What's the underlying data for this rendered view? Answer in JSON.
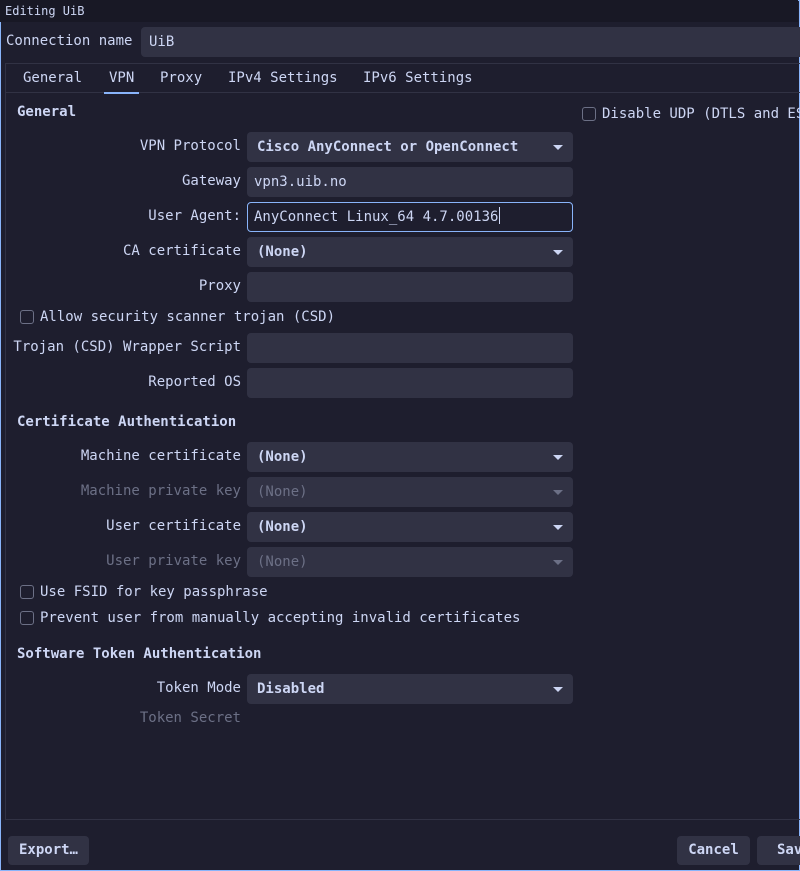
{
  "window": {
    "title": "Editing UiB"
  },
  "connection": {
    "label": "Connection name",
    "value": "UiB"
  },
  "tabs": [
    {
      "label": "General"
    },
    {
      "label": "VPN"
    },
    {
      "label": "Proxy"
    },
    {
      "label": "IPv4 Settings"
    },
    {
      "label": "IPv6 Settings"
    }
  ],
  "active_tab": "VPN",
  "general": {
    "heading": "General",
    "vpn_protocol": {
      "label": "VPN Protocol",
      "value": "Cisco AnyConnect or OpenConnect"
    },
    "gateway": {
      "label": "Gateway",
      "value": "vpn3.uib.no"
    },
    "user_agent": {
      "label": "User Agent:",
      "value": "AnyConnect Linux_64 4.7.00136"
    },
    "ca_certificate": {
      "label": "CA certificate",
      "value": "(None)"
    },
    "proxy": {
      "label": "Proxy",
      "value": ""
    },
    "allow_csd": {
      "label": "Allow security scanner trojan (CSD)",
      "checked": false
    },
    "csd_wrapper": {
      "label": "Trojan (CSD) Wrapper Script",
      "value": ""
    },
    "reported_os": {
      "label": "Reported OS",
      "value": ""
    },
    "disable_udp": {
      "label": "Disable UDP (DTLS and ES",
      "checked": false
    }
  },
  "cert_auth": {
    "heading": "Certificate Authentication",
    "machine_cert": {
      "label": "Machine certificate",
      "value": "(None)"
    },
    "machine_key": {
      "label": "Machine private key",
      "value": "(None)"
    },
    "user_cert": {
      "label": "User certificate",
      "value": "(None)"
    },
    "user_key": {
      "label": "User private key",
      "value": "(None)"
    },
    "use_fsid": {
      "label": "Use FSID for key passphrase",
      "checked": false
    },
    "prevent_invalid": {
      "label": "Prevent user from manually accepting invalid certificates",
      "checked": false
    }
  },
  "token_auth": {
    "heading": "Software Token Authentication",
    "token_mode": {
      "label": "Token Mode",
      "value": "Disabled"
    },
    "token_secret": {
      "label": "Token Secret"
    }
  },
  "buttons": {
    "export": "Export…",
    "cancel": "Cancel",
    "save": "Save"
  },
  "colors": {
    "background": "#1e1e2e",
    "field": "#313244",
    "accent": "#89b4fa",
    "text": "#cdd6f4",
    "dim": "#6c7086"
  }
}
